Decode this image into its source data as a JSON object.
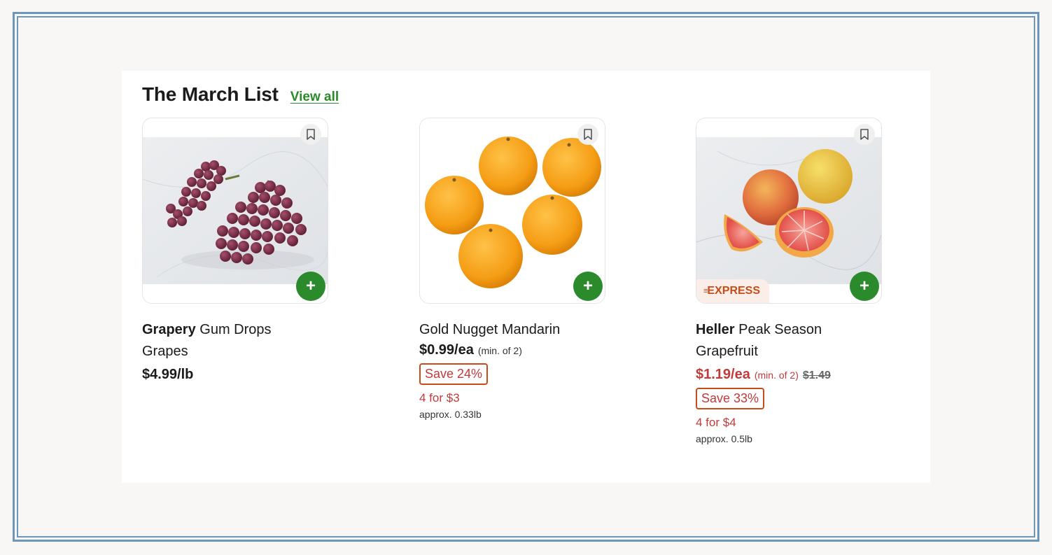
{
  "section": {
    "title": "The March List",
    "view_all": "View all"
  },
  "products": [
    {
      "brand": "Grapery",
      "name": "Gum Drops Grapes",
      "price": "$4.99/lb",
      "min": "",
      "original_price": "",
      "save": "",
      "deal": "",
      "approx": "",
      "express": ""
    },
    {
      "brand": "",
      "name": "Gold Nugget Mandarin",
      "price": "$0.99/ea",
      "min": "(min. of 2)",
      "original_price": "",
      "save": "Save 24%",
      "deal": "4 for $3",
      "approx": "approx. 0.33lb",
      "express": ""
    },
    {
      "brand": "Heller",
      "name": "Peak Season Grapefruit",
      "price": "$1.19/ea",
      "min": "(min. of 2)",
      "original_price": "$1.49",
      "save": "Save 33%",
      "deal": "4 for $4",
      "approx": "approx. 0.5lb",
      "express": "EXPRESS"
    }
  ],
  "icons": {
    "bookmark": "bookmark-icon",
    "add": "plus-icon",
    "express": "speed-lines-icon"
  },
  "colors": {
    "accent_green": "#2b8a2b",
    "sale_red": "#c23a3a",
    "express_orange": "#c64d1a",
    "frame_blue": "#6d96bd"
  }
}
